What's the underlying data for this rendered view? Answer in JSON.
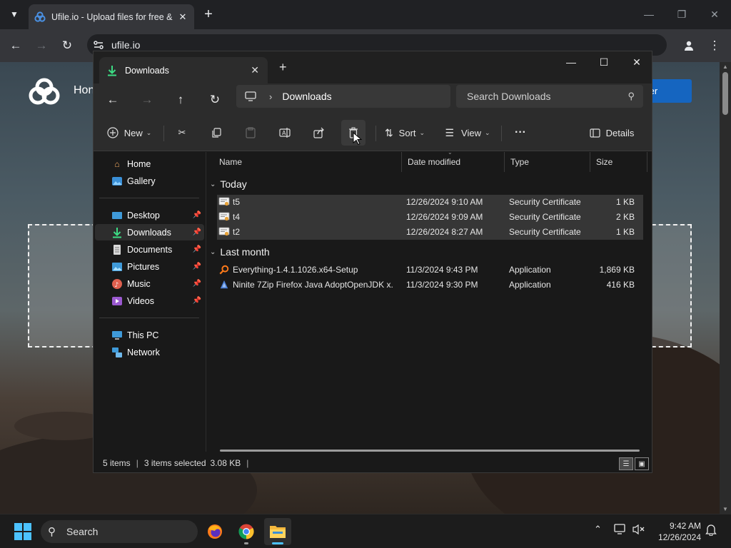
{
  "browser": {
    "tab_title": "Ufile.io - Upload files for free &",
    "url": "ufile.io"
  },
  "webpage": {
    "home_label": "Hon",
    "register_label": "ter"
  },
  "explorer": {
    "tab_title": "Downloads",
    "breadcrumb": "Downloads",
    "search_placeholder": "Search Downloads",
    "toolbar": {
      "new_label": "New",
      "sort_label": "Sort",
      "view_label": "View",
      "more_label": "···",
      "details_label": "Details"
    },
    "nav": {
      "home": "Home",
      "gallery": "Gallery",
      "desktop": "Desktop",
      "downloads": "Downloads",
      "documents": "Documents",
      "pictures": "Pictures",
      "music": "Music",
      "videos": "Videos",
      "this_pc": "This PC",
      "network": "Network"
    },
    "columns": {
      "name": "Name",
      "date": "Date modified",
      "type": "Type",
      "size": "Size"
    },
    "groups": {
      "today": {
        "label": "Today",
        "files": [
          {
            "name": "t5",
            "date": "12/26/2024 9:10 AM",
            "type": "Security Certificate",
            "size": "1 KB",
            "selected": true
          },
          {
            "name": "t4",
            "date": "12/26/2024 9:09 AM",
            "type": "Security Certificate",
            "size": "2 KB",
            "selected": true
          },
          {
            "name": "t2",
            "date": "12/26/2024 8:27 AM",
            "type": "Security Certificate",
            "size": "1 KB",
            "selected": true
          }
        ]
      },
      "last_month": {
        "label": "Last month",
        "files": [
          {
            "name": "Everything-1.4.1.1026.x64-Setup",
            "date": "11/3/2024 9:43 PM",
            "type": "Application",
            "size": "1,869 KB",
            "selected": false
          },
          {
            "name": "Ninite 7Zip Firefox Java AdoptOpenJDK x...",
            "date": "11/3/2024 9:30 PM",
            "type": "Application",
            "size": "416 KB",
            "selected": false
          }
        ]
      }
    },
    "status": {
      "item_count": "5 items",
      "selection": "3 items selected",
      "selection_size": "3.08 KB"
    }
  },
  "taskbar": {
    "search_label": "Search",
    "time": "9:42 AM",
    "date": "12/26/2024"
  },
  "colors": {
    "accent": "#4cc2ff",
    "register_button": "#1565c0",
    "downloads_icon": "#3ddc84"
  }
}
